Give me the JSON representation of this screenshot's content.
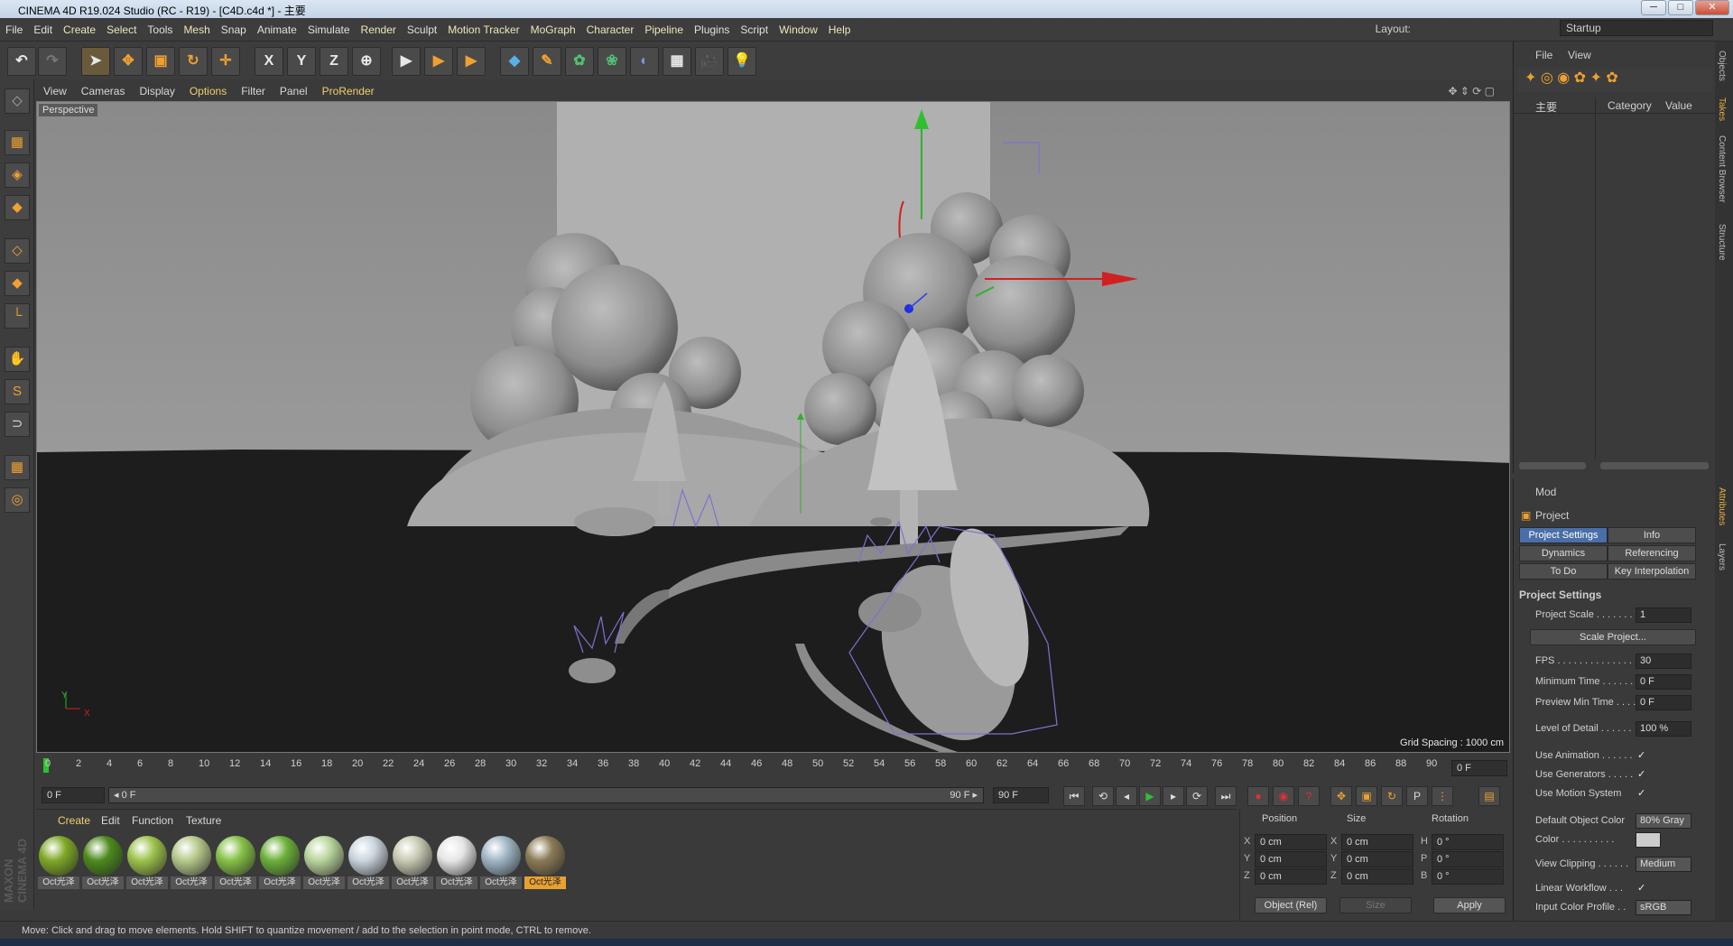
{
  "window": {
    "title": "CINEMA 4D R19.024 Studio (RC - R19) - [C4D.c4d *] - 主要",
    "controls": [
      "─",
      "□",
      "✕"
    ]
  },
  "menu": [
    "File",
    "Edit",
    "Create",
    "Select",
    "Tools",
    "Mesh",
    "Snap",
    "Animate",
    "Simulate",
    "Render",
    "Sculpt",
    "Motion Tracker",
    "MoGraph",
    "Character",
    "Pipeline",
    "Plugins",
    "Script",
    "Window",
    "Help"
  ],
  "layout": {
    "label": "Layout:",
    "value": "Startup"
  },
  "toolbar": {
    "undo": "↶",
    "redo": "↷",
    "select": "➤",
    "move": "✥",
    "scale": "▣",
    "rotate": "↻",
    "move2": "✛",
    "x": "X",
    "y": "Y",
    "z": "Z",
    "world": "⊕",
    "render1": "▶",
    "render2": "▶",
    "render3": "▶",
    "cube": "◆",
    "pen": "✎",
    "gen": "✿",
    "deform": "❀",
    "env": "◐",
    "floor": "▦",
    "camera": "🎥",
    "light": "💡"
  },
  "lefttools": [
    "◇",
    "▦",
    "◈",
    "◆",
    "◇",
    "◆",
    "└",
    "✋",
    "S",
    "⊃",
    "▦",
    "◎"
  ],
  "viewport": {
    "menu": [
      "View",
      "Cameras",
      "Display",
      "Options",
      "Filter",
      "Panel",
      "ProRender"
    ],
    "highlight": [
      "Options",
      "ProRender"
    ],
    "label": "Perspective",
    "grid_spacing": "Grid Spacing : 1000 cm",
    "axis_y": "Y",
    "axis_x": "X"
  },
  "timeline": {
    "ticks": [
      "0",
      "2",
      "4",
      "6",
      "8",
      "10",
      "12",
      "14",
      "16",
      "18",
      "20",
      "22",
      "24",
      "26",
      "28",
      "30",
      "32",
      "34",
      "36",
      "38",
      "40",
      "42",
      "44",
      "46",
      "48",
      "50",
      "52",
      "54",
      "56",
      "58",
      "60",
      "62",
      "64",
      "66",
      "68",
      "70",
      "72",
      "74",
      "76",
      "78",
      "80",
      "82",
      "84",
      "86",
      "88",
      "90"
    ],
    "current_frame": "0 F",
    "start": "0 F",
    "range_start": "◂ 0 F",
    "range_end": "90 F ▸",
    "end": "90 F"
  },
  "playback": [
    "⏮",
    "⟲",
    "◂",
    "▶",
    "▸",
    "⟳",
    "⏭"
  ],
  "material_tabs": [
    "Create",
    "Edit",
    "Function",
    "Texture"
  ],
  "materials": [
    {
      "label": "Oct光泽",
      "color": "#7fa826"
    },
    {
      "label": "Oct光泽",
      "color": "#4d8a1c"
    },
    {
      "label": "Oct光泽",
      "color": "#9cc24a"
    },
    {
      "label": "Oct光泽",
      "color": "#b5c98a"
    },
    {
      "label": "Oct光泽",
      "color": "#86c046"
    },
    {
      "label": "Oct光泽",
      "color": "#6cb03a"
    },
    {
      "label": "Oct光泽",
      "color": "#b8d49a"
    },
    {
      "label": "Oct光泽",
      "color": "#c9d4dc"
    },
    {
      "label": "Oct光泽",
      "color": "#c8c9b2"
    },
    {
      "label": "Oct光泽",
      "color": "#e6e6e6"
    },
    {
      "label": "Oct光泽",
      "color": "#9fb6c4"
    },
    {
      "label": "Oct光泽",
      "color": "#8b7a55"
    }
  ],
  "coordinates": {
    "headers": [
      "Position",
      "Size",
      "Rotation"
    ],
    "rows": [
      {
        "a1": "X",
        "v1": "0 cm",
        "a2": "X",
        "v2": "0 cm",
        "a3": "H",
        "v3": "0 °"
      },
      {
        "a1": "Y",
        "v1": "0 cm",
        "a2": "Y",
        "v2": "0 cm",
        "a3": "P",
        "v3": "0 °"
      },
      {
        "a1": "Z",
        "v1": "0 cm",
        "a2": "Z",
        "v2": "0 cm",
        "a3": "B",
        "v3": "0 °"
      }
    ],
    "mode": "Object (Rel)",
    "size_mode": "Size",
    "apply": "Apply"
  },
  "status": "Move: Click and drag to move elements. Hold SHIFT to quantize movement / add to the selection in point mode, CTRL to remove.",
  "object_manager": {
    "menu": [
      "File",
      "View"
    ],
    "columns": [
      "主要",
      "Category",
      "Value"
    ]
  },
  "attributes": {
    "mode": "Mod",
    "object": "Project",
    "tabs": [
      "Project Settings",
      "Info",
      "Dynamics",
      "Referencing",
      "To Do",
      "Key Interpolation"
    ],
    "section": "Project Settings",
    "scale_project": "Scale Project...",
    "props": [
      {
        "label": "Project Scale . . . . . . .",
        "value": "1"
      },
      {
        "label": "FPS . . . . . . . . . . . . . . .",
        "value": "30"
      },
      {
        "label": "Minimum Time . . . . . .",
        "value": "0 F"
      },
      {
        "label": "Preview Min Time . . . .",
        "value": "0 F"
      },
      {
        "label": "Level of Detail . . . . . .",
        "value": "100 %"
      }
    ],
    "checks": [
      {
        "label": "Use Animation . . . . . .",
        "value": "✓"
      },
      {
        "label": "Use Generators . . . . .",
        "value": "✓"
      },
      {
        "label": "Use Motion System",
        "value": "✓"
      }
    ],
    "default_color_label": "Default Object Color",
    "default_color_value": "80% Gray",
    "color_label": "Color . . . . . . . . . .",
    "view_clipping_label": "View Clipping . . . . . .",
    "view_clipping_value": "Medium",
    "linear_workflow_label": "Linear Workflow . . .",
    "linear_workflow_value": "✓",
    "input_profile_label": "Input Color Profile . .",
    "input_profile_value": "sRGB"
  },
  "side_tabs": [
    "Objects",
    "Takes",
    "Content Browser",
    "Structure",
    "Attributes",
    "Layers"
  ],
  "brand": "MAXON CINEMA 4D"
}
